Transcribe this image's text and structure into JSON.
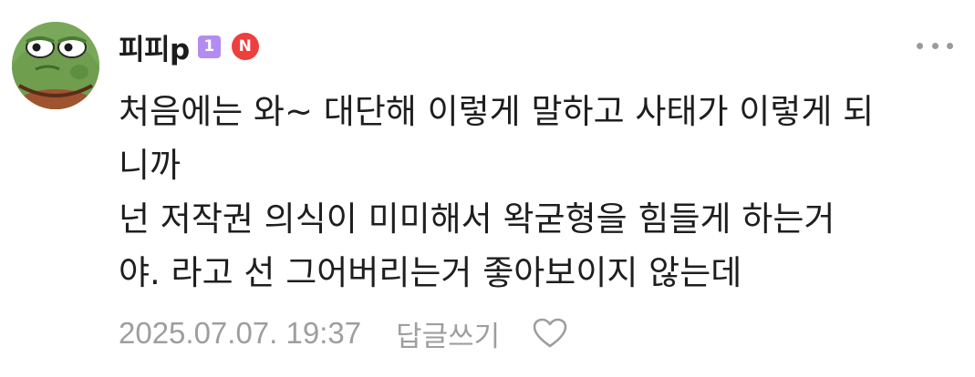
{
  "comment": {
    "author": "피피p",
    "level_badge": "1",
    "new_badge": "N",
    "body_lines": [
      "처음에는 와~ 대단해 이렇게 말하고 사태가 이렇게 되",
      "니까",
      "넌 저작권 의식이 미미해서 왁굳형을 힘들게 하는거",
      "야. 라고 선 그어버리는거 좋아보이지 않는데"
    ],
    "timestamp": "2025.07.07. 19:37",
    "reply_label": "답글쓰기"
  },
  "icons": {
    "avatar": "frog-avatar",
    "more": "more-horizontal-icon",
    "like": "heart-outline-icon"
  },
  "colors": {
    "level_badge": "#b38cf2",
    "new_badge": "#ef3e3e",
    "meta_text": "#9e9e9e",
    "body_text": "#1e1e1e"
  }
}
